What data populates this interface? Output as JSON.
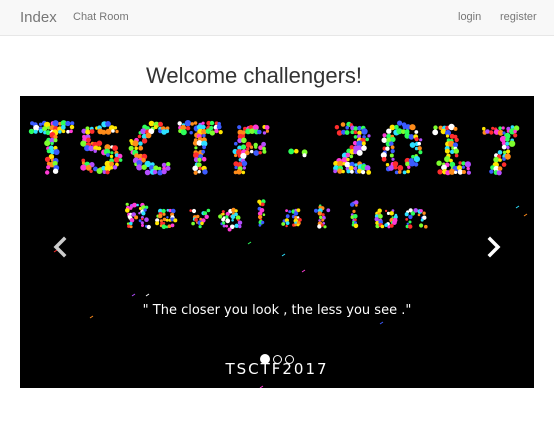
{
  "navbar": {
    "brand": "Index",
    "chat_room": "Chat Room",
    "login": "login",
    "register": "register"
  },
  "page": {
    "title": "Welcome challengers!"
  },
  "carousel": {
    "quote": "\" The closer you look , the less you see .\"",
    "caption": "TSCTF2017",
    "slide_count": 3,
    "active_slide": 1,
    "banner_title_text": "TSCTF-2017",
    "banner_subtitle_text": "Revelation"
  }
}
